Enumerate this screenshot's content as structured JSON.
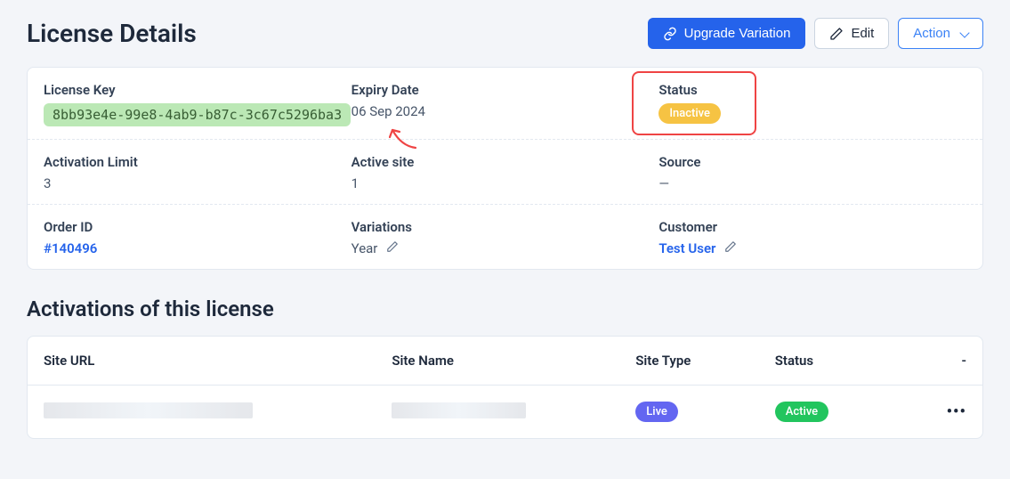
{
  "page": {
    "title": "License Details",
    "activations_title": "Activations of this license"
  },
  "buttons": {
    "upgrade": "Upgrade Variation",
    "edit": "Edit",
    "action": "Action"
  },
  "license": {
    "key_label": "License Key",
    "key_value": "8bb93e4e-99e8-4ab9-b87c-3c67c5296ba3",
    "expiry_label": "Expiry Date",
    "expiry_value": "06 Sep 2024",
    "status_label": "Status",
    "status_value": "Inactive",
    "activation_limit_label": "Activation Limit",
    "activation_limit_value": "3",
    "active_site_label": "Active site",
    "active_site_value": "1",
    "source_label": "Source",
    "source_value": "—",
    "order_id_label": "Order ID",
    "order_id_value": "#140496",
    "variations_label": "Variations",
    "variations_value": "Year",
    "customer_label": "Customer",
    "customer_value": "Test User"
  },
  "table": {
    "columns": {
      "site_url": "Site URL",
      "site_name": "Site Name",
      "site_type": "Site Type",
      "status": "Status",
      "actions": "-"
    },
    "rows": [
      {
        "site_type": "Live",
        "status": "Active"
      }
    ]
  }
}
